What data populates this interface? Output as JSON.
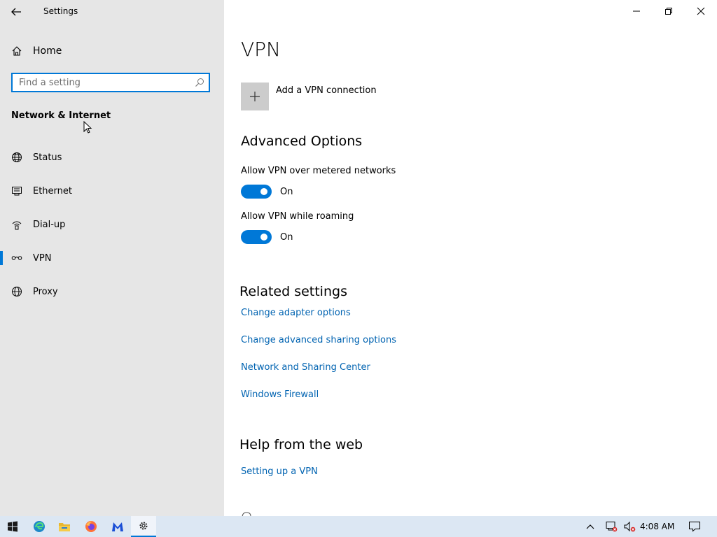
{
  "window": {
    "app_title": "Settings",
    "controls": [
      "minimize",
      "restore",
      "close"
    ]
  },
  "sidebar": {
    "home_label": "Home",
    "search_placeholder": "Find a setting",
    "section_title": "Network & Internet",
    "items": [
      {
        "label": "Status",
        "icon": "globe-network-icon",
        "selected": false
      },
      {
        "label": "Ethernet",
        "icon": "ethernet-icon",
        "selected": false
      },
      {
        "label": "Dial-up",
        "icon": "dialup-icon",
        "selected": false
      },
      {
        "label": "VPN",
        "icon": "vpn-icon",
        "selected": true
      },
      {
        "label": "Proxy",
        "icon": "globe-icon",
        "selected": false
      }
    ]
  },
  "main": {
    "title": "VPN",
    "add_vpn_label": "Add a VPN connection",
    "advanced_heading": "Advanced Options",
    "options": [
      {
        "label": "Allow VPN over metered networks",
        "state": "On"
      },
      {
        "label": "Allow VPN while roaming",
        "state": "On"
      }
    ],
    "related_heading": "Related settings",
    "related_links": [
      "Change adapter options",
      "Change advanced sharing options",
      "Network and Sharing Center",
      "Windows Firewall"
    ],
    "help_heading": "Help from the web",
    "help_links": [
      "Setting up a VPN"
    ]
  },
  "taskbar": {
    "clock": "4:08 AM",
    "apps": [
      "start-icon",
      "edge-icon",
      "file-explorer-icon",
      "firefox-icon",
      "malwarebytes-icon",
      "settings-icon"
    ]
  },
  "colors": {
    "accent": "#0078d7",
    "link": "#0063b1",
    "sidebar_bg": "#e6e6e6",
    "taskbar_bg": "#dce7f3"
  }
}
